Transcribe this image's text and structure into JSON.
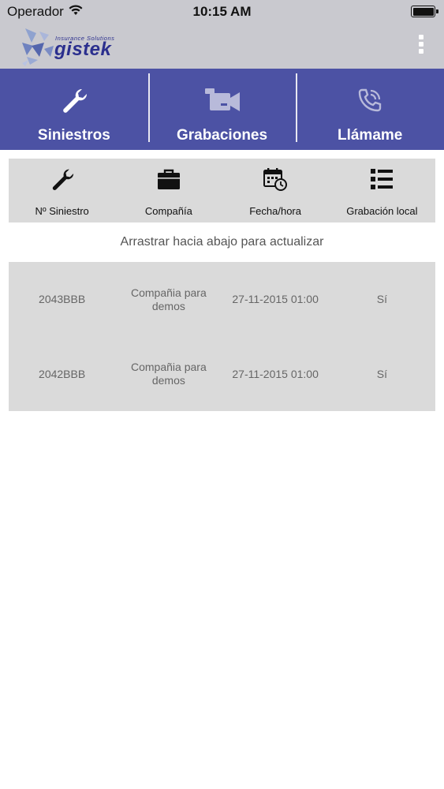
{
  "status_bar": {
    "carrier": "Operador",
    "time": "10:15 AM"
  },
  "header": {
    "logo_tagline": "Insurance Solutions",
    "logo_word": "gistek",
    "brand_color": "#2b2f8e"
  },
  "nav": {
    "items": [
      {
        "label": "Siniestros",
        "icon": "wrench-icon"
      },
      {
        "label": "Grabaciones",
        "icon": "video-camera-icon"
      },
      {
        "label": "Llámame",
        "icon": "phone-ringing-icon"
      }
    ],
    "background": "#4c52a4"
  },
  "columns": [
    {
      "label": "Nº Siniestro",
      "icon": "wrench-icon"
    },
    {
      "label": "Compañía",
      "icon": "briefcase-icon"
    },
    {
      "label": "Fecha/hora",
      "icon": "calendar-clock-icon"
    },
    {
      "label": "Grabación local",
      "icon": "list-icon"
    }
  ],
  "pull_hint": "Arrastrar hacia abajo para actualizar",
  "rows": [
    {
      "claim": "2043BBB",
      "company": "Compañia para demos",
      "datetime": "27-11-2015 01:00",
      "local": "Sí"
    },
    {
      "claim": "2042BBB",
      "company": "Compañia para demos",
      "datetime": "27-11-2015 01:00",
      "local": "Sí"
    }
  ]
}
